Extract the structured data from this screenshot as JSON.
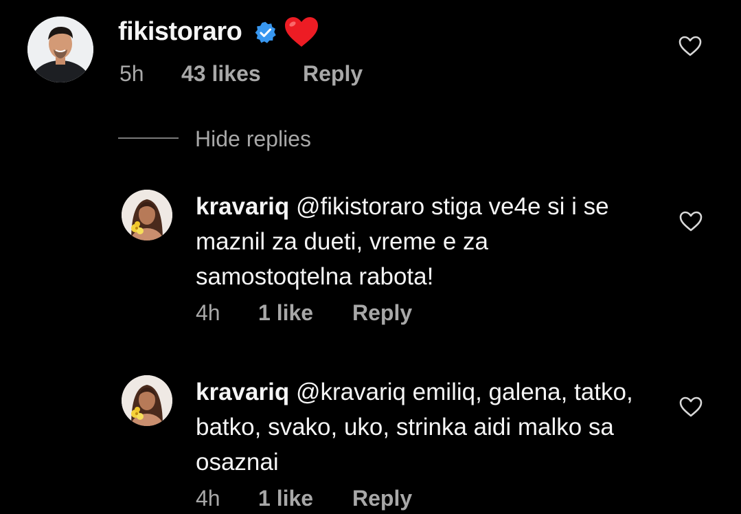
{
  "comment": {
    "username": "fikistoraro",
    "verified_icon": "verified-badge-icon",
    "emoji_icon": "red-heart-emoji",
    "time": "5h",
    "likes": "43 likes",
    "reply_label": "Reply",
    "like_icon": "heart-outline-icon"
  },
  "hide_replies_label": "Hide replies",
  "replies": [
    {
      "username": "kravariq",
      "text": " @fikistoraro stiga ve4e si i se maznil za dueti, vreme e za samostoqtelna rabota!",
      "time": "4h",
      "likes": "1 like",
      "reply_label": "Reply",
      "like_icon": "heart-outline-icon"
    },
    {
      "username": "kravariq",
      "text": " @kravariq emiliq, galena, tatko, batko, svako, uko, strinka aidi malko sa osaznai",
      "time": "4h",
      "likes": "1 like",
      "reply_label": "Reply",
      "like_icon": "heart-outline-icon"
    }
  ],
  "colors": {
    "background": "#000000",
    "primary_text": "#f5f5f5",
    "secondary_text": "#a8a8a8",
    "verified_blue": "#3897f0",
    "heart_red": "#ed1c24"
  }
}
